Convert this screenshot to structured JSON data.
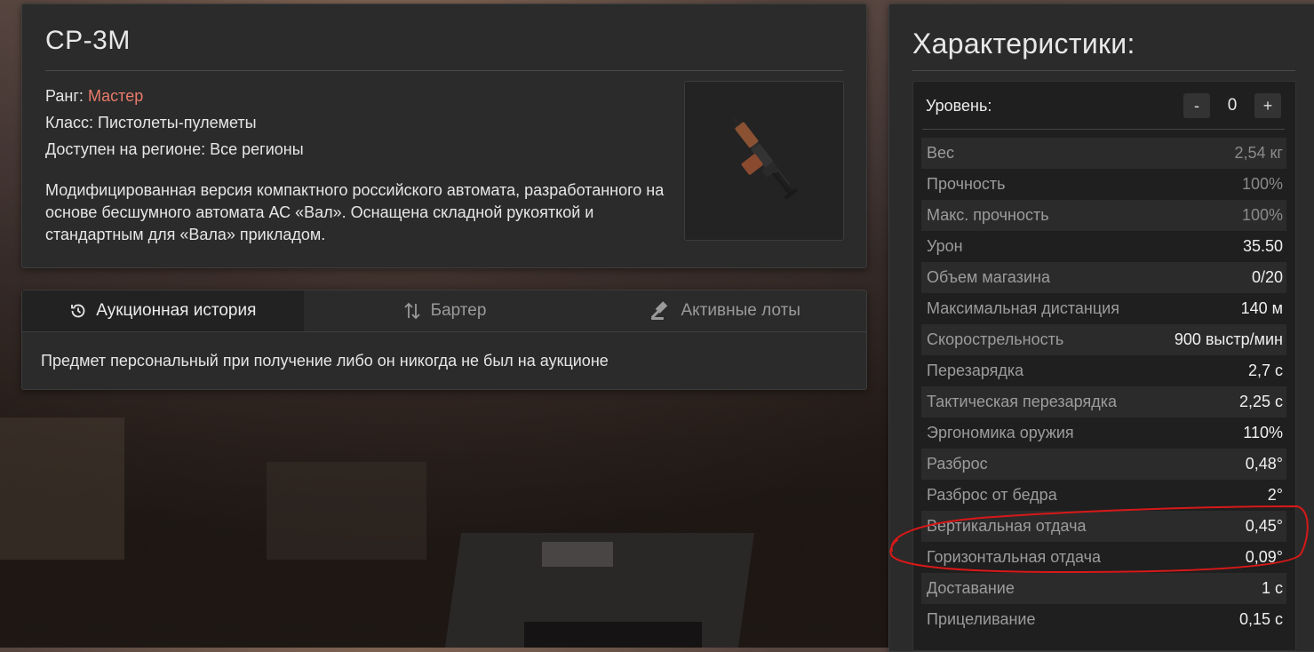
{
  "item": {
    "title": "СР-3М",
    "rank_label": "Ранг:",
    "rank_value": "Мастер",
    "class_line": "Класс: Пистолеты-пулеметы",
    "region_line": "Доступен на регионе: Все регионы",
    "description": "Модифицированная версия компактного российского автомата, разработанного на основе бесшумного автомата АС «Вал». Оснащена складной рукояткой и стандартным для «Вала» прикладом.",
    "image_icon": "rifle-icon"
  },
  "auction": {
    "tabs": [
      {
        "label": "Аукционная история",
        "icon": "history-icon"
      },
      {
        "label": "Бартер",
        "icon": "swap-arrows-icon"
      },
      {
        "label": "Активные лоты",
        "icon": "gavel-icon"
      }
    ],
    "message": "Предмет персональный при получение либо он никогда не был на аукционе"
  },
  "stats": {
    "title": "Характеристики:",
    "level_label": "Уровень:",
    "level_value": "0",
    "minus": "-",
    "plus": "+",
    "rows": [
      {
        "label": "Вес",
        "value": "2,54 кг"
      },
      {
        "label": "Прочность",
        "value": "100%"
      },
      {
        "label": "Макс. прочность",
        "value": "100%"
      },
      {
        "label": "Урон",
        "value": "35.50"
      },
      {
        "label": "Объем магазина",
        "value": "0/20"
      },
      {
        "label": "Максимальная дистанция",
        "value": "140 м"
      },
      {
        "label": "Скорострельность",
        "value": "900 выстр/мин"
      },
      {
        "label": "Перезарядка",
        "value": "2,7 с"
      },
      {
        "label": "Тактическая перезарядка",
        "value": "2,25 с"
      },
      {
        "label": "Эргономика оружия",
        "value": "110%"
      },
      {
        "label": "Разброс",
        "value": "0,48°"
      },
      {
        "label": "Разброс от бедра",
        "value": "2°"
      },
      {
        "label": "Вертикальная отдача",
        "value": "0,45°"
      },
      {
        "label": "Горизонтальная отдача",
        "value": "0,09°"
      },
      {
        "label": "Доставание",
        "value": "1 с"
      },
      {
        "label": "Прицеливание",
        "value": "0,15 с"
      }
    ]
  },
  "colors": {
    "rank": "#e87a6a",
    "annotation": "#d81818",
    "panel": "#2b2b2b"
  }
}
